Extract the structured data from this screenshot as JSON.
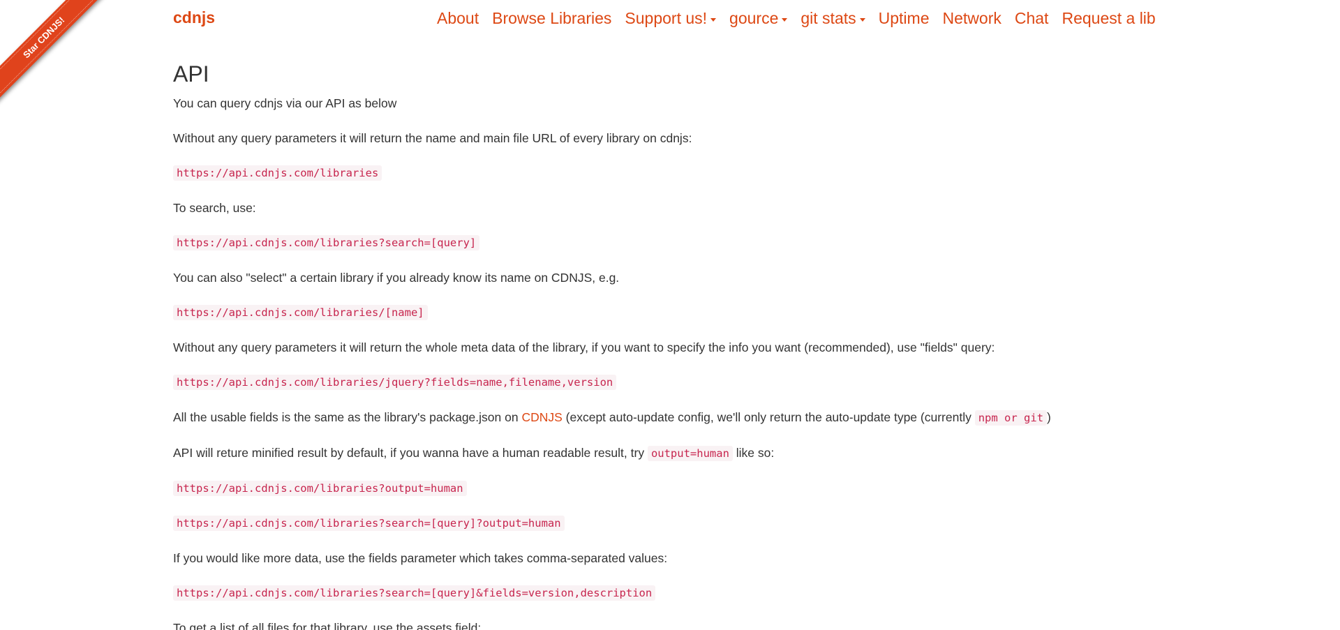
{
  "ribbon": {
    "label": "Star CDNJS!"
  },
  "navbar": {
    "brand": "cdnjs",
    "items": [
      {
        "label": "About",
        "dropdown": false
      },
      {
        "label": "Browse Libraries",
        "dropdown": false
      },
      {
        "label": "Support us!",
        "dropdown": true
      },
      {
        "label": "gource",
        "dropdown": true
      },
      {
        "label": "git stats",
        "dropdown": true
      },
      {
        "label": "Uptime",
        "dropdown": false
      },
      {
        "label": "Network",
        "dropdown": false
      },
      {
        "label": "Chat",
        "dropdown": false
      },
      {
        "label": "Request a lib",
        "dropdown": false
      }
    ]
  },
  "content": {
    "title": "API",
    "intro": "You can query cdnjs via our API as below",
    "no_params_text": "Without any query parameters it will return the name and main file URL of every library on cdnjs:",
    "url_libraries": "https://api.cdnjs.com/libraries",
    "search_text": "To search, use:",
    "url_search": "https://api.cdnjs.com/libraries?search=[query]",
    "select_text": "You can also \"select\" a certain library if you already know its name on CDNJS, e.g.",
    "url_name": "https://api.cdnjs.com/libraries/[name]",
    "fields_text": "Without any query parameters it will return the whole meta data of the library, if you want to specify the info you want (recommended), use \"fields\" query:",
    "url_fields": "https://api.cdnjs.com/libraries/jquery?fields=name,filename,version",
    "usable_fields": {
      "before": "All the usable fields is the same as the library's package.json on ",
      "link": "CDNJS",
      "middle": " (except auto-update config, we'll only return the auto-update type (currently ",
      "code": "npm or git",
      "after": ")"
    },
    "minified": {
      "before": "API will reture minified result by default, if you wanna have a human readable result, try ",
      "code": "output=human",
      "after": " like so:"
    },
    "url_output_human": "https://api.cdnjs.com/libraries?output=human",
    "url_search_output_human": "https://api.cdnjs.com/libraries?search=[query]?output=human",
    "more_data_text": "If you would like more data, use the fields parameter which takes comma-separated values:",
    "url_search_fields": "https://api.cdnjs.com/libraries?search=[query]&fields=version,description",
    "assets_text": "To get a list of all files for that library, use the assets field:"
  }
}
